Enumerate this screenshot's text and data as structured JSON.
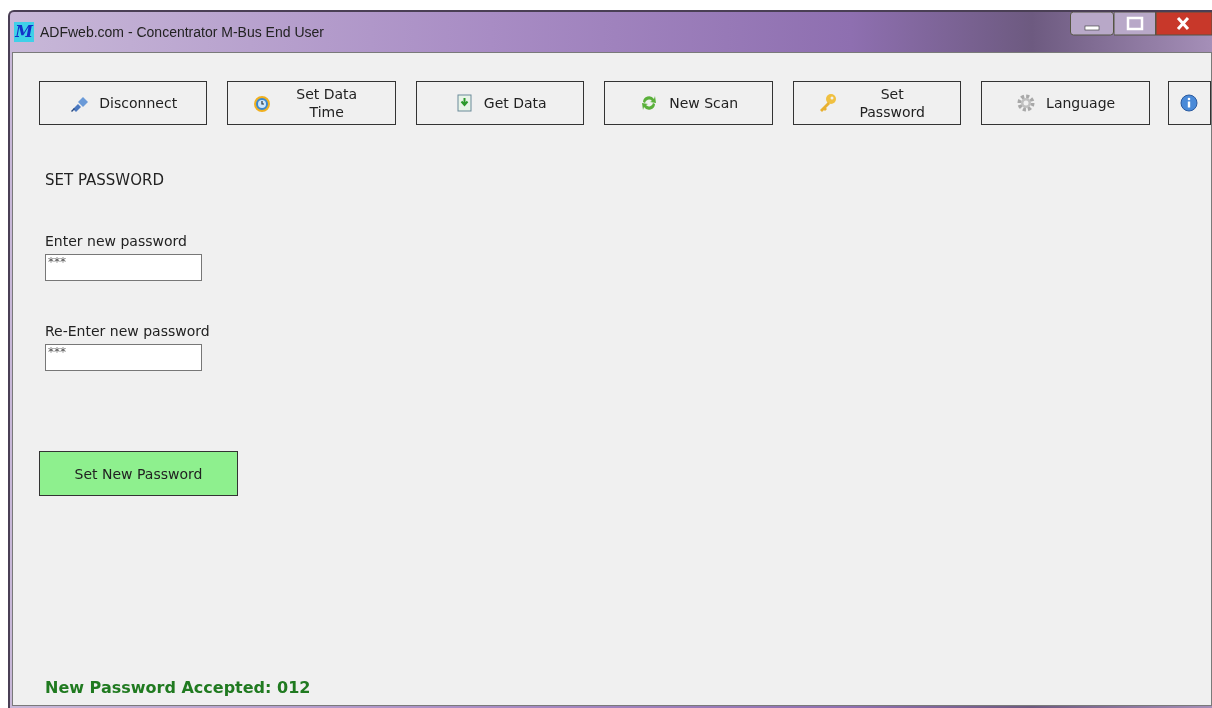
{
  "window": {
    "logo": "M",
    "title": "ADFweb.com - Concentrator M-Bus End User"
  },
  "toolbar": [
    {
      "kind": "plug",
      "label": "Disconnect"
    },
    {
      "kind": "clock",
      "label": "Set Data Time"
    },
    {
      "kind": "download",
      "label": "Get Data"
    },
    {
      "kind": "refresh",
      "label": "New Scan"
    },
    {
      "kind": "key",
      "label": "Set Password"
    },
    {
      "kind": "gear",
      "label": "Language"
    },
    {
      "kind": "info"
    }
  ],
  "section_title": "SET PASSWORD",
  "fields": [
    {
      "label": "Enter new password",
      "value": "***"
    },
    {
      "label": "Re-Enter new password",
      "value": "***"
    }
  ],
  "submit_button": "Set New Password",
  "status_message": "New Password Accepted: 012"
}
